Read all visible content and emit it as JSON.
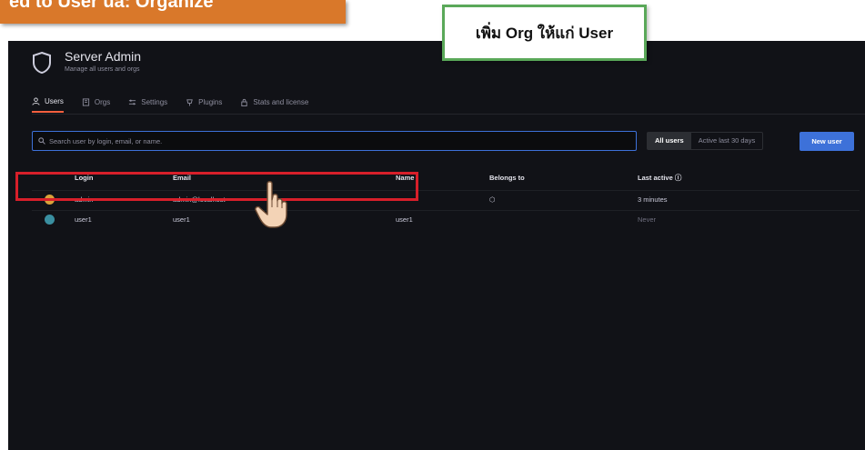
{
  "banner": {
    "text": "ed to User ua: Organize"
  },
  "callout": {
    "text": "เพิ่ม Org ให้แก่ User"
  },
  "header": {
    "title": "Server Admin",
    "subtitle": "Manage all users and orgs"
  },
  "tabs": [
    {
      "label": "Users",
      "icon": "user-icon",
      "active": true
    },
    {
      "label": "Orgs",
      "icon": "building-icon",
      "active": false
    },
    {
      "label": "Settings",
      "icon": "sliders-icon",
      "active": false
    },
    {
      "label": "Plugins",
      "icon": "plug-icon",
      "active": false
    },
    {
      "label": "Stats and license",
      "icon": "lock-icon",
      "active": false
    }
  ],
  "search": {
    "placeholder": "Search user by login, email, or name.",
    "value": ""
  },
  "filter": {
    "options": [
      "All users",
      "Active last 30 days"
    ],
    "selected": "All users"
  },
  "new_user_label": "New user",
  "table": {
    "columns": {
      "login": "Login",
      "email": "Email",
      "name": "Name",
      "belongs": "Belongs to",
      "last_active": "Last active ⓘ"
    },
    "rows": [
      {
        "login": "admin",
        "email": "admin@localhost",
        "name": "",
        "belongs": "⬡",
        "last_active": "3 minutes",
        "avatar_color": "#d9a23a"
      },
      {
        "login": "user1",
        "email": "user1",
        "name": "user1",
        "belongs": "",
        "last_active": "Never",
        "avatar_color": "#3a8fa0"
      }
    ]
  },
  "colors": {
    "accent": "#3d71d9",
    "active_tab": "#f55f3e",
    "highlight": "#d81f2a",
    "callout_border": "#5aa859",
    "banner": "#d9782a"
  }
}
